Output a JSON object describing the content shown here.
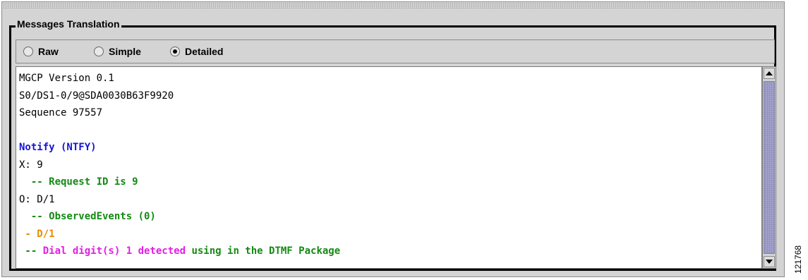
{
  "group": {
    "title": "Messages Translation"
  },
  "view_modes": [
    {
      "label": "Raw",
      "selected": false
    },
    {
      "label": "Simple",
      "selected": false
    },
    {
      "label": "Detailed",
      "selected": true
    }
  ],
  "message": {
    "lines": [
      {
        "segments": [
          {
            "text": "MGCP Version 0.1",
            "style": "plain"
          }
        ]
      },
      {
        "segments": [
          {
            "text": "S0/DS1-0/9@SDA0030B63F9920",
            "style": "plain"
          }
        ]
      },
      {
        "segments": [
          {
            "text": "Sequence 97557",
            "style": "plain"
          }
        ]
      },
      {
        "segments": [
          {
            "text": "",
            "style": "plain"
          }
        ]
      },
      {
        "segments": [
          {
            "text": "Notify (NTFY)",
            "style": "bold-blue"
          }
        ]
      },
      {
        "segments": [
          {
            "text": "X: 9",
            "style": "plain"
          }
        ]
      },
      {
        "segments": [
          {
            "text": "  -- Request ID is 9",
            "style": "bold-green"
          }
        ]
      },
      {
        "segments": [
          {
            "text": "O: D/1",
            "style": "plain"
          }
        ]
      },
      {
        "segments": [
          {
            "text": "  -- ObservedEvents (0)",
            "style": "bold-green"
          }
        ]
      },
      {
        "segments": [
          {
            "text": " - D/1",
            "style": "bold-orange"
          }
        ]
      },
      {
        "segments": [
          {
            "text": " -- ",
            "style": "bold-green"
          },
          {
            "text": "Dial digit(s) 1 detected",
            "style": "bold-magenta"
          },
          {
            "text": " using in the DTMF Package",
            "style": "bold-green"
          }
        ]
      }
    ]
  },
  "figure_number": "121768",
  "colors": {
    "blue": "#1515d6",
    "green": "#148a14",
    "orange": "#e98a00",
    "magenta": "#e21ee2",
    "scroll_thumb": "#a3a3cc"
  }
}
